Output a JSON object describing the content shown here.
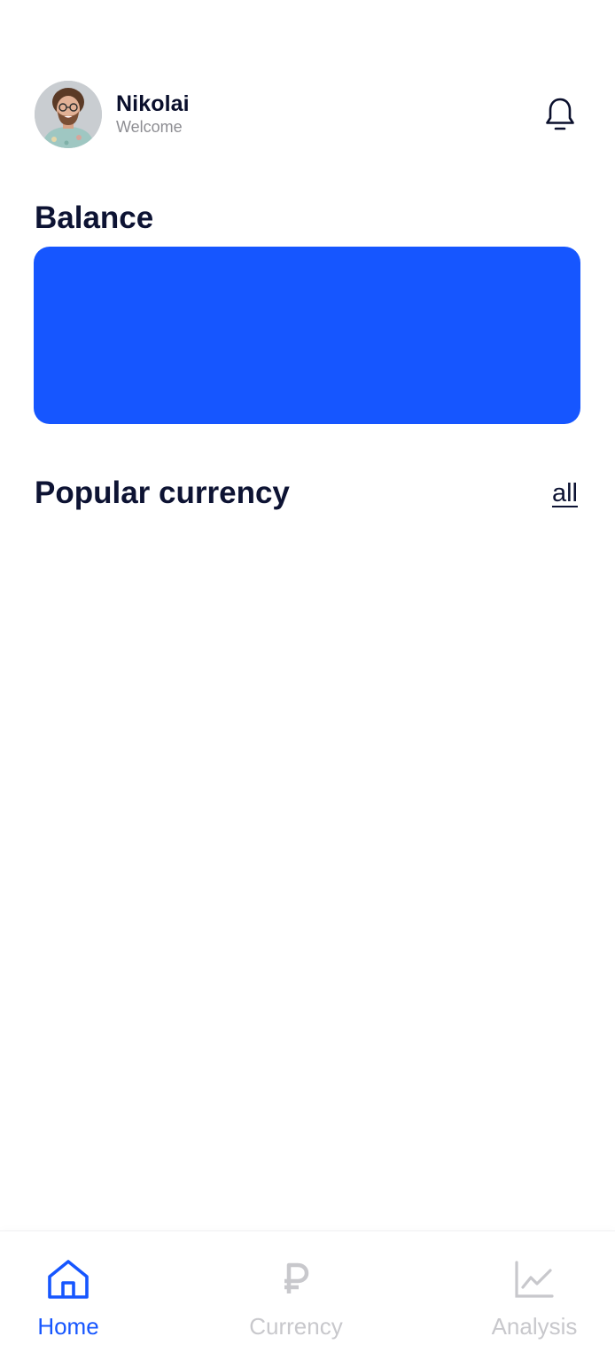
{
  "header": {
    "user_name": "Nikolai",
    "subtitle": "Welcome",
    "avatar_icon": "user-avatar",
    "notification_icon": "bell-icon"
  },
  "balance": {
    "title": "Balance",
    "card_color": "#1656ff"
  },
  "popular_currency": {
    "title": "Popular currency",
    "all_link": "all"
  },
  "bottom_nav": {
    "items": [
      {
        "label": "Home",
        "icon": "home-icon",
        "active": true
      },
      {
        "label": "Currency",
        "icon": "ruble-icon",
        "active": false
      },
      {
        "label": "Analysis",
        "icon": "chart-icon",
        "active": false
      }
    ]
  },
  "colors": {
    "accent": "#1656ff",
    "text_dark": "#0d1333",
    "text_muted": "#8e8e93",
    "inactive": "#c8c8cc"
  }
}
